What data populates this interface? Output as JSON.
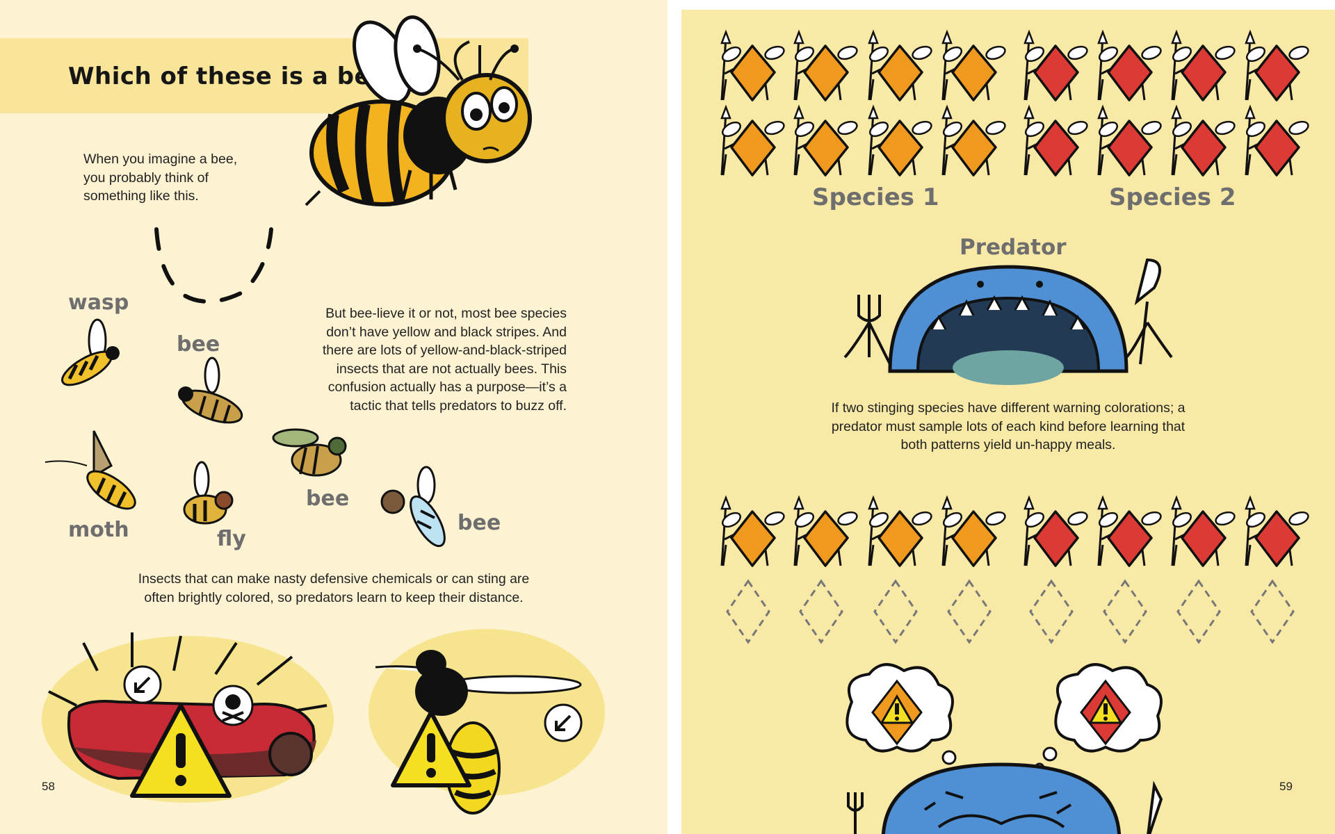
{
  "left_page": {
    "title": "Which of these is a bee?",
    "intro_lines": [
      "When you imagine a bee,",
      "you probably think of",
      "something like this."
    ],
    "body_lines": [
      "But bee-lieve it or not, most bee species",
      "don’t have yellow and black stripes. And",
      "there are lots of yellow-and-black-striped",
      "insects that are not actually bees. This",
      "confusion actually has a purpose—it’s a",
      "tactic that tells predators to buzz off."
    ],
    "insect_labels": {
      "wasp": "wasp",
      "bee_1": "bee",
      "bee_2": "bee",
      "bee_3": "bee",
      "moth": "moth",
      "fly": "fly"
    },
    "warning_lines": [
      "Insects that can make nasty defensive chemicals or can sting are",
      "often brightly colored, so predators learn to keep their distance."
    ],
    "page_number": "58",
    "icons": [
      "cartoon-bee",
      "wasp",
      "moth",
      "fly",
      "caterpillar",
      "warning-triangle",
      "skull-crossbones-icon",
      "arrow-cursor-icon"
    ]
  },
  "right_page": {
    "species_1_label": "Species 1",
    "species_2_label": "Species 2",
    "predator_label": "Predator",
    "caption_lines": [
      "If two stinging species have different warning colorations; a",
      "predator must sample lots of each kind before learning that",
      "both patterns yield un-happy meals."
    ],
    "page_number": "59",
    "colors": {
      "species_1": "#ef9a1f",
      "species_2": "#dc3a35",
      "predator": "#4f8fd4",
      "warning": "#f4df21"
    },
    "icons": [
      "diamond-soldier",
      "shark-predator",
      "fork-icon",
      "knife-icon",
      "thought-bubble",
      "warning-diamond-icon"
    ]
  }
}
